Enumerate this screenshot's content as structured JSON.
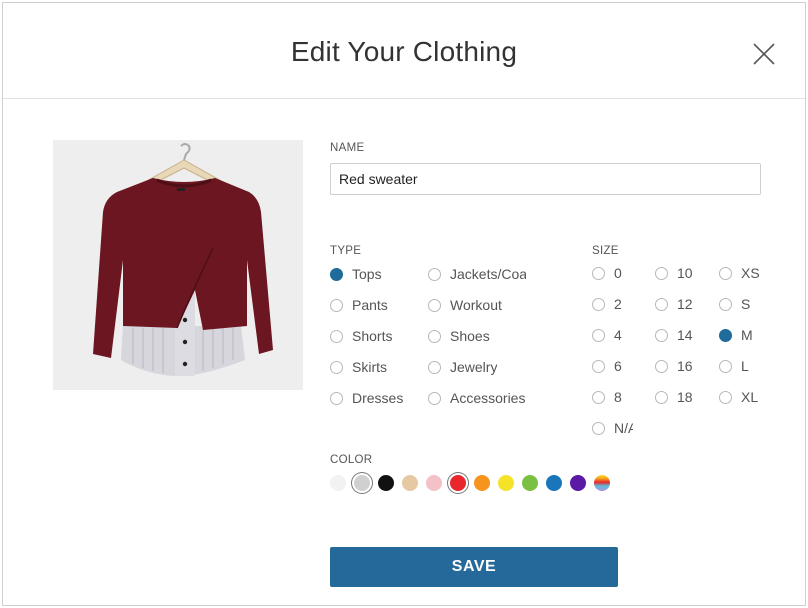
{
  "dialog": {
    "title": "Edit Your Clothing",
    "close_icon": "close-icon"
  },
  "item_photo": {
    "icon": "red-sweater-on-hanger",
    "garment_color": "#6b1620"
  },
  "name": {
    "label": "NAME",
    "value": "Red sweater"
  },
  "type": {
    "label": "TYPE",
    "options": [
      {
        "label": "Tops",
        "checked": true
      },
      {
        "label": "Pants",
        "checked": false
      },
      {
        "label": "Shorts",
        "checked": false
      },
      {
        "label": "Skirts",
        "checked": false
      },
      {
        "label": "Dresses",
        "checked": false
      },
      {
        "label": "Jackets/Coats",
        "checked": false
      },
      {
        "label": "Workout",
        "checked": false
      },
      {
        "label": "Shoes",
        "checked": false
      },
      {
        "label": "Jewelry",
        "checked": false
      },
      {
        "label": "Accessories",
        "checked": false
      }
    ]
  },
  "size": {
    "label": "SIZE",
    "options": [
      {
        "label": "0",
        "checked": false
      },
      {
        "label": "2",
        "checked": false
      },
      {
        "label": "4",
        "checked": false
      },
      {
        "label": "6",
        "checked": false
      },
      {
        "label": "8",
        "checked": false
      },
      {
        "label": "N/A",
        "checked": false
      },
      {
        "label": "10",
        "checked": false
      },
      {
        "label": "12",
        "checked": false
      },
      {
        "label": "14",
        "checked": false
      },
      {
        "label": "16",
        "checked": false
      },
      {
        "label": "18",
        "checked": false
      },
      {
        "label": "XS",
        "checked": false
      },
      {
        "label": "S",
        "checked": false
      },
      {
        "label": "M",
        "checked": true
      },
      {
        "label": "L",
        "checked": false
      },
      {
        "label": "XL",
        "checked": false
      }
    ]
  },
  "color": {
    "label": "COLOR",
    "swatches": [
      {
        "name": "white",
        "hex": "#f2f2f2",
        "selected": false
      },
      {
        "name": "gray",
        "hex": "#d0d0d0",
        "selected": true
      },
      {
        "name": "black",
        "hex": "#111111",
        "selected": false
      },
      {
        "name": "beige",
        "hex": "#e6c9a3",
        "selected": false
      },
      {
        "name": "pink",
        "hex": "#f5c1c9",
        "selected": false
      },
      {
        "name": "red",
        "hex": "#e8262b",
        "selected": true
      },
      {
        "name": "orange",
        "hex": "#f7941d",
        "selected": false
      },
      {
        "name": "yellow",
        "hex": "#f7e22a",
        "selected": false
      },
      {
        "name": "green",
        "hex": "#7ac143",
        "selected": false
      },
      {
        "name": "blue",
        "hex": "#1b75bb",
        "selected": false
      },
      {
        "name": "purple",
        "hex": "#5b1aa5",
        "selected": false
      },
      {
        "name": "multicolor",
        "hex": "gradient",
        "selected": false
      }
    ]
  },
  "actions": {
    "save_label": "SAVE"
  },
  "colors": {
    "accent": "#25699b",
    "radio_checked": "#1f6b9c"
  }
}
